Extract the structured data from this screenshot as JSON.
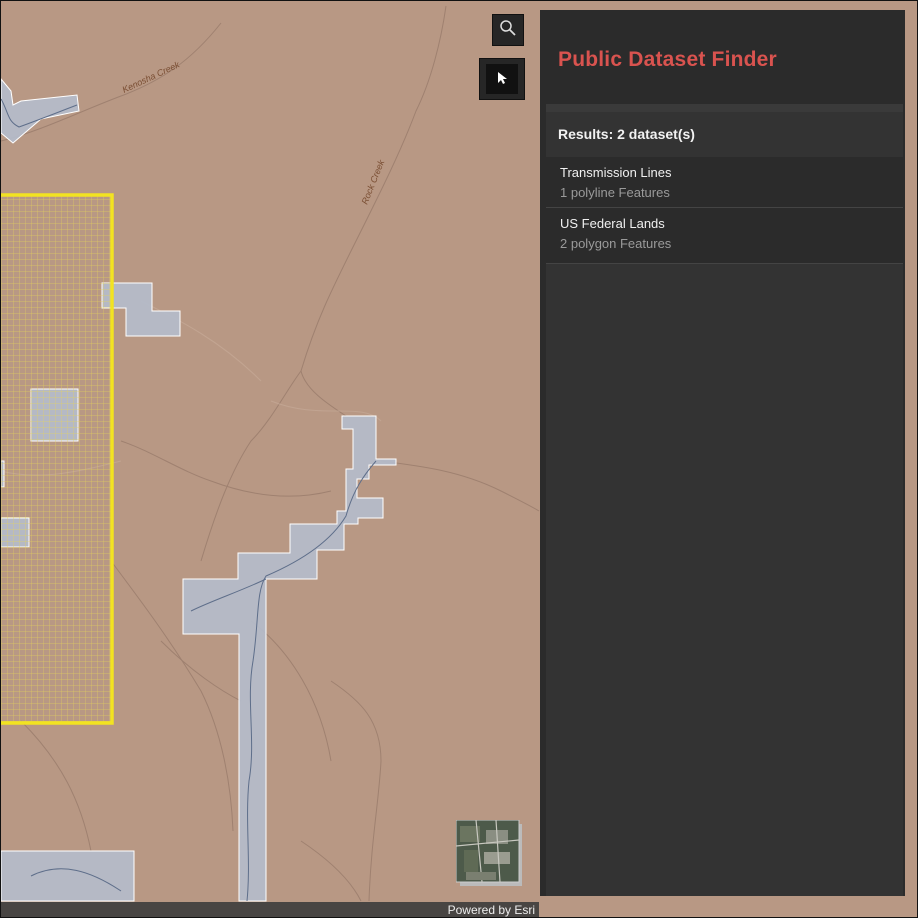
{
  "panel": {
    "title": "Public Dataset Finder",
    "results_title": "Results: 2 dataset(s)",
    "results": [
      {
        "name": "Transmission Lines",
        "description": "1 polyline Features"
      },
      {
        "name": "US Federal Lands",
        "description": "2 polygon Features"
      }
    ]
  },
  "map": {
    "labels": {
      "creek_1": "Kenosha Creek",
      "creek_2": "Rock Creek"
    },
    "attribution": "Powered by Esri",
    "basemap_icon": "imagery-basemap-thumbnail"
  },
  "toolbar": {
    "search_icon": "search-icon",
    "select_icon": "cursor-select-icon"
  },
  "colors": {
    "map_background": "#b89884",
    "federal_lands_fill": "#b4bccb",
    "selection_outline": "#f2e321",
    "panel_title": "#d9534f",
    "panel_background": "#2b2b2b"
  }
}
